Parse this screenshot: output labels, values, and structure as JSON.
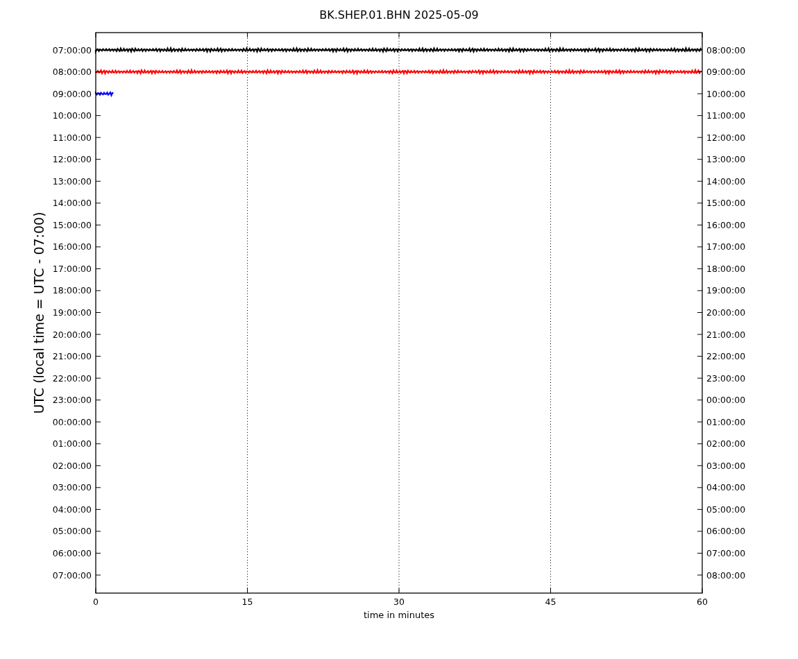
{
  "plot": {
    "title": "BK.SHEP.01.BHN 2025-05-09",
    "ylabel": "UTC (local time = UTC - 07:00)",
    "xlabel": "time in minutes",
    "xticks": [
      "0",
      "15",
      "30",
      "45",
      "60"
    ],
    "left_ticks": [
      "07:00:00",
      "08:00:00",
      "09:00:00",
      "10:00:00",
      "11:00:00",
      "12:00:00",
      "13:00:00",
      "14:00:00",
      "15:00:00",
      "16:00:00",
      "17:00:00",
      "18:00:00",
      "19:00:00",
      "20:00:00",
      "21:00:00",
      "22:00:00",
      "23:00:00",
      "00:00:00",
      "01:00:00",
      "02:00:00",
      "03:00:00",
      "04:00:00",
      "05:00:00",
      "06:00:00",
      "07:00:00"
    ],
    "right_ticks": [
      "08:00:00",
      "09:00:00",
      "10:00:00",
      "11:00:00",
      "12:00:00",
      "13:00:00",
      "14:00:00",
      "15:00:00",
      "16:00:00",
      "17:00:00",
      "18:00:00",
      "19:00:00",
      "20:00:00",
      "21:00:00",
      "22:00:00",
      "23:00:00",
      "00:00:00",
      "01:00:00",
      "02:00:00",
      "03:00:00",
      "04:00:00",
      "05:00:00",
      "06:00:00",
      "07:00:00",
      "08:00:00"
    ],
    "traces": [
      {
        "color": "#000000",
        "kind": "full"
      },
      {
        "color": "#ff0000",
        "kind": "full"
      },
      {
        "color": "#0000ff",
        "kind": "short"
      }
    ]
  }
}
